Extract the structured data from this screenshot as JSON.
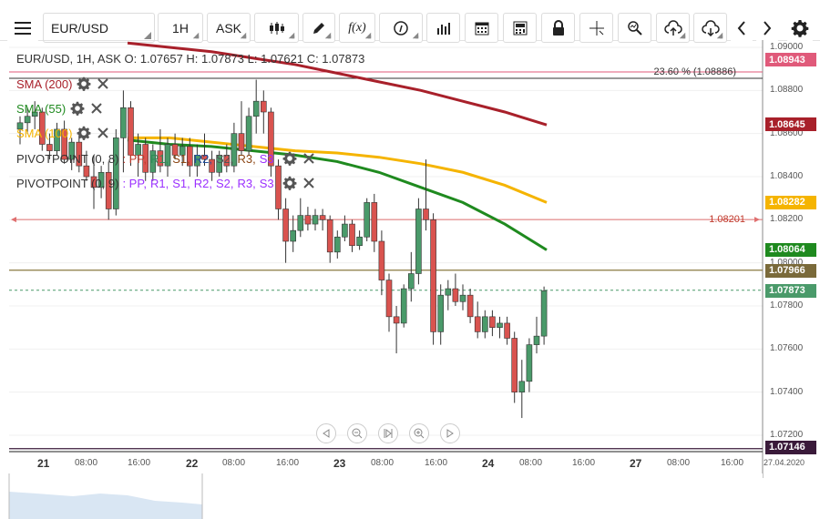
{
  "toolbar": {
    "symbol": "EUR/USD",
    "timeframe": "1H",
    "price_type": "ASK",
    "fx_label": "f(x)",
    "icons": [
      "menu-icon",
      "candlestick-icon",
      "pencil-icon",
      "function-icon",
      "info-icon",
      "bar-chart-icon",
      "calendar-icon",
      "calculator-icon",
      "lock-icon",
      "crosshair-icon",
      "zoom-icon",
      "cloud-upload-icon",
      "cloud-download-icon",
      "chevron-left-icon",
      "chevron-right-icon",
      "gear-icon"
    ]
  },
  "legend": {
    "ohlc": "EUR/USD, 1H, ASK   O: 1.07657 H: 1.07873 L: 1.07621 C: 1.07873",
    "sma200": "SMA (200)",
    "sma55": "SMA (55)",
    "sma100": "SMA (100)",
    "pivot8": "PIVOTPOINT (0, 8)",
    "pivot9": "PIVOTPOINT (0, 9)",
    "pivot_parts": [
      {
        "t": ": PP,",
        "c": "#c0392b"
      },
      {
        "t": "R1,",
        "c": "#2e8b57"
      },
      {
        "t": "S1,",
        "c": "#8b4513"
      },
      {
        "t": "R2,",
        "c": "#1f4e9c"
      },
      {
        "t": "S2,",
        "c": "#555"
      },
      {
        "t": "R3,",
        "c": "#8b4513"
      },
      {
        "t": "S3",
        "c": "#9b30ff"
      }
    ],
    "pivot_parts2": [
      {
        "t": ": PP,",
        "c": "#9b30ff"
      },
      {
        "t": "R1,",
        "c": "#9b30ff"
      },
      {
        "t": "S1,",
        "c": "#9b30ff"
      },
      {
        "t": "R2,",
        "c": "#9b30ff"
      },
      {
        "t": "S2,",
        "c": "#9b30ff"
      },
      {
        "t": "R3,",
        "c": "#9b30ff"
      },
      {
        "t": "S3",
        "c": "#9b30ff"
      }
    ]
  },
  "fib_label": "23.60 % (1.08886)",
  "hline_label": "1.08201",
  "price_axis": [
    "1.09000",
    "1.08800",
    "1.08600",
    "1.08400",
    "1.08200",
    "1.08000",
    "1.07800",
    "1.07600",
    "1.07400",
    "1.07200"
  ],
  "price_tags": [
    {
      "v": "1.08943",
      "bg": "#e05a7a",
      "name": "tag-fib"
    },
    {
      "v": "1.08645",
      "bg": "#a8202a",
      "name": "tag-sma200"
    },
    {
      "v": "1.08282",
      "bg": "#f5b400",
      "name": "tag-sma100"
    },
    {
      "v": "1.08064",
      "bg": "#1f8a1f",
      "name": "tag-sma55"
    },
    {
      "v": "1.07966",
      "bg": "#7a6a3a",
      "name": "tag-level"
    },
    {
      "v": "1.07873",
      "bg": "#4a9a6a",
      "name": "tag-last"
    },
    {
      "v": "1.07146",
      "bg": "#3a1a3a",
      "name": "tag-bottom"
    }
  ],
  "time_axis": [
    {
      "t": "21",
      "day": true
    },
    {
      "t": "08:00"
    },
    {
      "t": "16:00"
    },
    {
      "t": "22",
      "day": true
    },
    {
      "t": "08:00"
    },
    {
      "t": "16:00"
    },
    {
      "t": "23",
      "day": true
    },
    {
      "t": "08:00"
    },
    {
      "t": "16:00"
    },
    {
      "t": "24",
      "day": true
    },
    {
      "t": "08:00"
    },
    {
      "t": "16:00"
    },
    {
      "t": "27",
      "day": true
    },
    {
      "t": "08:00"
    },
    {
      "t": "16:00"
    },
    {
      "t": "27.04.2020"
    }
  ],
  "chart_data": {
    "type": "candlestick",
    "symbol": "EUR/USD",
    "ylim": [
      1.0712,
      1.0902
    ],
    "candles": [
      [
        1.0862,
        1.0868,
        1.0855,
        1.0865
      ],
      [
        1.0865,
        1.0872,
        1.086,
        1.0868
      ],
      [
        1.0868,
        1.0875,
        1.0862,
        1.087
      ],
      [
        1.087,
        1.0872,
        1.0852,
        1.0855
      ],
      [
        1.0855,
        1.086,
        1.0848,
        1.0852
      ],
      [
        1.0852,
        1.0865,
        1.085,
        1.0862
      ],
      [
        1.0862,
        1.0866,
        1.0846,
        1.0848
      ],
      [
        1.0848,
        1.0858,
        1.0843,
        1.0856
      ],
      [
        1.0856,
        1.086,
        1.0842,
        1.0845
      ],
      [
        1.0845,
        1.0852,
        1.0838,
        1.084
      ],
      [
        1.084,
        1.085,
        1.0825,
        1.0835
      ],
      [
        1.0835,
        1.0845,
        1.083,
        1.0842
      ],
      [
        1.0842,
        1.0847,
        1.082,
        1.0825
      ],
      [
        1.0825,
        1.0862,
        1.0822,
        1.0858
      ],
      [
        1.0858,
        1.088,
        1.0842,
        1.0872
      ],
      [
        1.0872,
        1.0875,
        1.0845,
        1.085
      ],
      [
        1.085,
        1.086,
        1.084,
        1.0855
      ],
      [
        1.0855,
        1.0858,
        1.0838,
        1.0842
      ],
      [
        1.0842,
        1.0855,
        1.0838,
        1.0852
      ],
      [
        1.0852,
        1.0862,
        1.0842,
        1.0845
      ],
      [
        1.0845,
        1.0858,
        1.084,
        1.0855
      ],
      [
        1.0855,
        1.086,
        1.0848,
        1.085
      ],
      [
        1.085,
        1.0858,
        1.0845,
        1.0854
      ],
      [
        1.0854,
        1.0858,
        1.084,
        1.0845
      ],
      [
        1.0845,
        1.0855,
        1.084,
        1.085
      ],
      [
        1.085,
        1.086,
        1.0845,
        1.0848
      ],
      [
        1.0848,
        1.0852,
        1.0838,
        1.0842
      ],
      [
        1.0842,
        1.0852,
        1.084,
        1.085
      ],
      [
        1.085,
        1.0855,
        1.0842,
        1.0845
      ],
      [
        1.0845,
        1.0865,
        1.0842,
        1.086
      ],
      [
        1.086,
        1.0875,
        1.085,
        1.0852
      ],
      [
        1.0852,
        1.0872,
        1.085,
        1.0868
      ],
      [
        1.0868,
        1.0885,
        1.086,
        1.0875
      ],
      [
        1.0875,
        1.088,
        1.086,
        1.087
      ],
      [
        1.087,
        1.0872,
        1.084,
        1.0845
      ],
      [
        1.0845,
        1.0848,
        1.082,
        1.0825
      ],
      [
        1.0825,
        1.083,
        1.08,
        1.081
      ],
      [
        1.081,
        1.0822,
        1.0805,
        1.0815
      ],
      [
        1.0815,
        1.083,
        1.0812,
        1.0822
      ],
      [
        1.0822,
        1.0826,
        1.0815,
        1.0818
      ],
      [
        1.0818,
        1.0825,
        1.0815,
        1.0822
      ],
      [
        1.0822,
        1.0825,
        1.0815,
        1.082
      ],
      [
        1.082,
        1.0822,
        1.08,
        1.0805
      ],
      [
        1.0805,
        1.0815,
        1.0802,
        1.0812
      ],
      [
        1.0812,
        1.0822,
        1.081,
        1.0818
      ],
      [
        1.0818,
        1.082,
        1.0805,
        1.0808
      ],
      [
        1.0808,
        1.0815,
        1.0806,
        1.0812
      ],
      [
        1.0812,
        1.083,
        1.081,
        1.0828
      ],
      [
        1.0828,
        1.0832,
        1.0805,
        1.081
      ],
      [
        1.081,
        1.0815,
        1.0785,
        1.0792
      ],
      [
        1.0792,
        1.0795,
        1.0768,
        1.0775
      ],
      [
        1.0775,
        1.078,
        1.0758,
        1.0772
      ],
      [
        1.0772,
        1.079,
        1.077,
        1.0788
      ],
      [
        1.0788,
        1.0805,
        1.0782,
        1.0795
      ],
      [
        1.0795,
        1.083,
        1.079,
        1.0825
      ],
      [
        1.0825,
        1.0848,
        1.0815,
        1.082
      ],
      [
        1.082,
        1.0823,
        1.0762,
        1.0768
      ],
      [
        1.0768,
        1.079,
        1.0762,
        1.0785
      ],
      [
        1.0785,
        1.0792,
        1.0778,
        1.0788
      ],
      [
        1.0788,
        1.0795,
        1.078,
        1.0782
      ],
      [
        1.0782,
        1.079,
        1.0778,
        1.0785
      ],
      [
        1.0785,
        1.0788,
        1.0772,
        1.0775
      ],
      [
        1.0775,
        1.0782,
        1.0765,
        1.0768
      ],
      [
        1.0768,
        1.0778,
        1.0765,
        1.0775
      ],
      [
        1.0775,
        1.0778,
        1.0766,
        1.077
      ],
      [
        1.077,
        1.0775,
        1.0765,
        1.0772
      ],
      [
        1.0772,
        1.0775,
        1.0762,
        1.0765
      ],
      [
        1.0765,
        1.0768,
        1.0735,
        1.074
      ],
      [
        1.074,
        1.0755,
        1.0728,
        1.0745
      ],
      [
        1.0745,
        1.0765,
        1.074,
        1.0762
      ],
      [
        1.0762,
        1.0775,
        1.0758,
        1.0766
      ],
      [
        1.0766,
        1.0789,
        1.0762,
        1.0787
      ]
    ],
    "sma200": [
      1.0902,
      1.09,
      1.0898,
      1.0895,
      1.0892,
      1.0888,
      1.0884,
      1.088,
      1.0875,
      1.087,
      1.0864
    ],
    "sma100": [
      1.0858,
      1.0858,
      1.0856,
      1.0854,
      1.0852,
      1.0851,
      1.0849,
      1.0846,
      1.0842,
      1.0836,
      1.0828
    ],
    "sma55": [
      1.0857,
      1.0855,
      1.0854,
      1.0852,
      1.085,
      1.0847,
      1.0842,
      1.0835,
      1.0828,
      1.0818,
      1.0806
    ],
    "levels": {
      "fib": 1.08886,
      "hline": 1.08201,
      "level_olive": 1.07966,
      "last": 1.07873,
      "bottom": 1.07146
    }
  }
}
